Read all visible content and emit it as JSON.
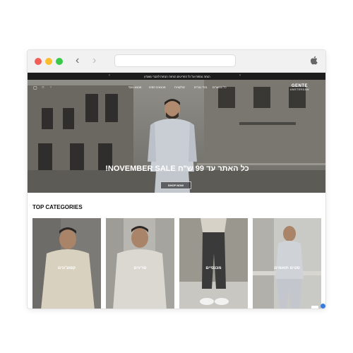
{
  "browser": {
    "back_icon": "chevron-left-icon",
    "forward_icon": "chevron-right-icon",
    "url": "",
    "apple_icon": "apple-icon"
  },
  "announcement": {
    "text": "הנחה נוספת על כל הפריטים הוחזרו הנחות לחברי מועדון"
  },
  "header": {
    "logo_line1": "GENTE",
    "logo_line2": "AMSTERDAM",
    "menu": [
      "כל המוצרים",
      "בגדי גברים",
      "קולקציות",
      "מבצעים חמים",
      "מבצע נוסף"
    ],
    "icons": [
      "bag-icon",
      "search-icon",
      "user-icon"
    ]
  },
  "hero": {
    "title": "!NOVEMBER SALE כל האתר עד 99 ש\"ח",
    "button": "SHOP NOW"
  },
  "categories_title": "TOP CATEGORIES",
  "categories": [
    {
      "label": "קפוצ'ונים",
      "bg": "#7c7a76",
      "shirt": "#d9d1bf"
    },
    {
      "label": "סריגים",
      "bg": "#b8b6b1",
      "shirt": "#dad8d1"
    },
    {
      "label": "מכנסיים",
      "bg": "#9a978f",
      "shirt": "#3a3a3a"
    },
    {
      "label": "סטים תואמים",
      "bg": "#c9c9c6",
      "shirt": "#cfd3d8"
    }
  ],
  "colors": {
    "accent": "#3b7be0",
    "announce_bg": "#1c1c1c"
  }
}
